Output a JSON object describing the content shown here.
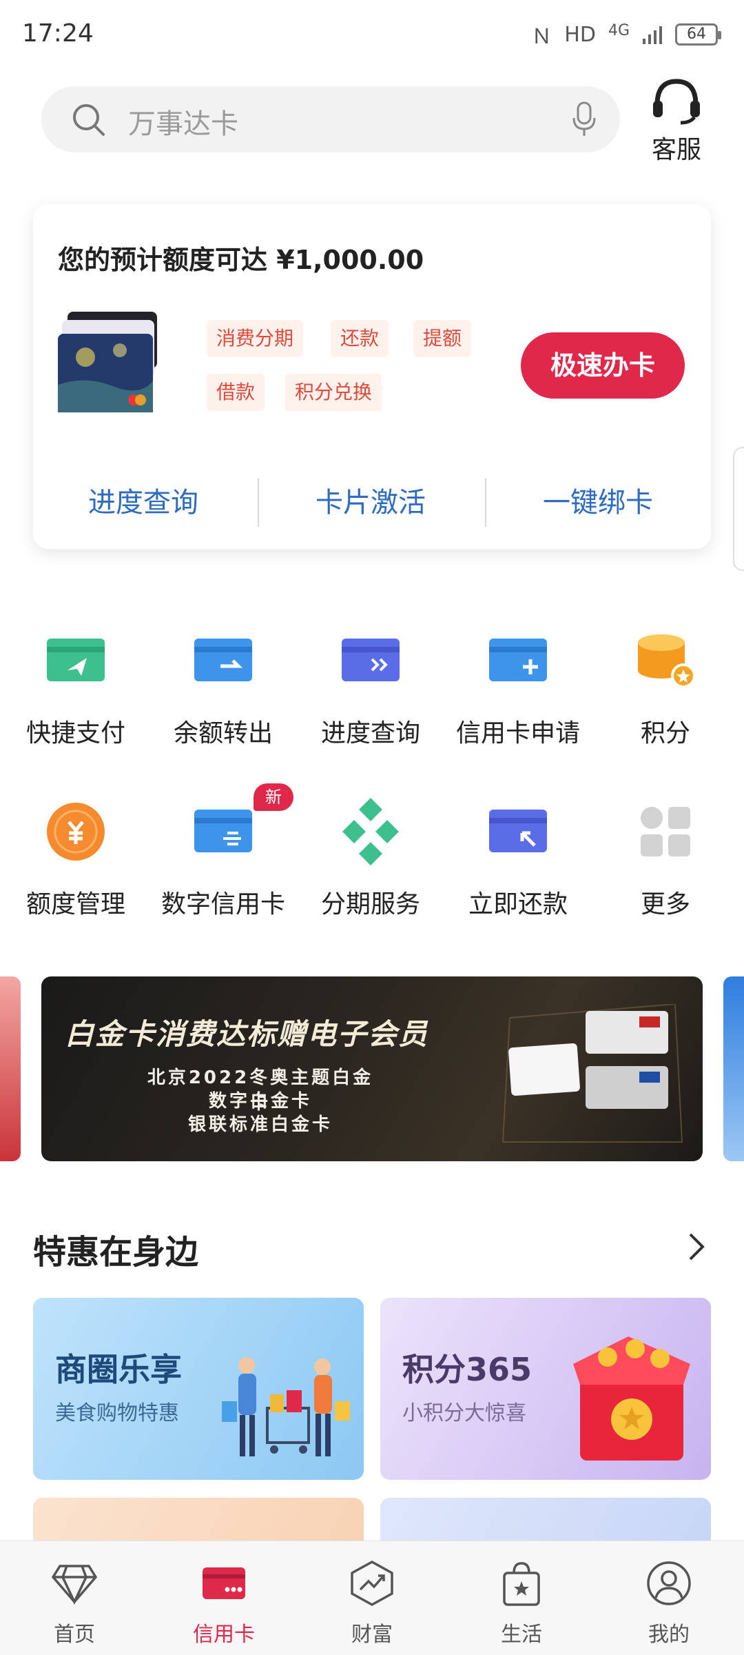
{
  "status": {
    "time": "17:24",
    "network": "HD",
    "signal": "4G",
    "battery": "64"
  },
  "search": {
    "placeholder": "万事达卡"
  },
  "service": {
    "label": "客服"
  },
  "panel": {
    "title": "您的预计额度可达 ¥1,000.00",
    "tags": [
      "消费分期",
      "还款",
      "提额",
      "借款",
      "积分兑换"
    ],
    "apply_label": "极速办卡",
    "quick_links": [
      "进度查询",
      "卡片激活",
      "一键绑卡"
    ]
  },
  "grid": [
    {
      "label": "快捷支付",
      "icon": "quick-pay-icon"
    },
    {
      "label": "余额转出",
      "icon": "balance-transfer-icon"
    },
    {
      "label": "进度查询",
      "icon": "progress-query-icon"
    },
    {
      "label": "信用卡申请",
      "icon": "card-apply-icon"
    },
    {
      "label": "积分",
      "icon": "points-icon"
    },
    {
      "label": "额度管理",
      "icon": "limit-manage-icon"
    },
    {
      "label": "数字信用卡",
      "icon": "digital-card-icon",
      "badge": "新"
    },
    {
      "label": "分期服务",
      "icon": "installment-icon"
    },
    {
      "label": "立即还款",
      "icon": "repay-icon"
    },
    {
      "label": "更多",
      "icon": "more-icon"
    }
  ],
  "banner": {
    "headline": "白金卡消费达标赠电子会员",
    "lines": [
      "北京2022冬奥主题白金卡",
      "数字白金卡",
      "银联标准白金卡"
    ]
  },
  "section": {
    "title": "特惠在身边"
  },
  "promos": [
    {
      "title": "商圈乐享",
      "subtitle": "美食购物特惠"
    },
    {
      "title": "积分365",
      "subtitle": "小积分大惊喜"
    }
  ],
  "tabs": [
    {
      "label": "首页",
      "icon": "diamond-icon",
      "active": false
    },
    {
      "label": "信用卡",
      "icon": "credit-card-icon",
      "active": true
    },
    {
      "label": "财富",
      "icon": "wealth-chart-icon",
      "active": false
    },
    {
      "label": "生活",
      "icon": "shopping-bag-icon",
      "active": false
    },
    {
      "label": "我的",
      "icon": "profile-icon",
      "active": false
    }
  ],
  "colors": {
    "brand_red": "#e0284a",
    "link_blue": "#2c6bbf",
    "tag_bg": "#fff1ec"
  }
}
